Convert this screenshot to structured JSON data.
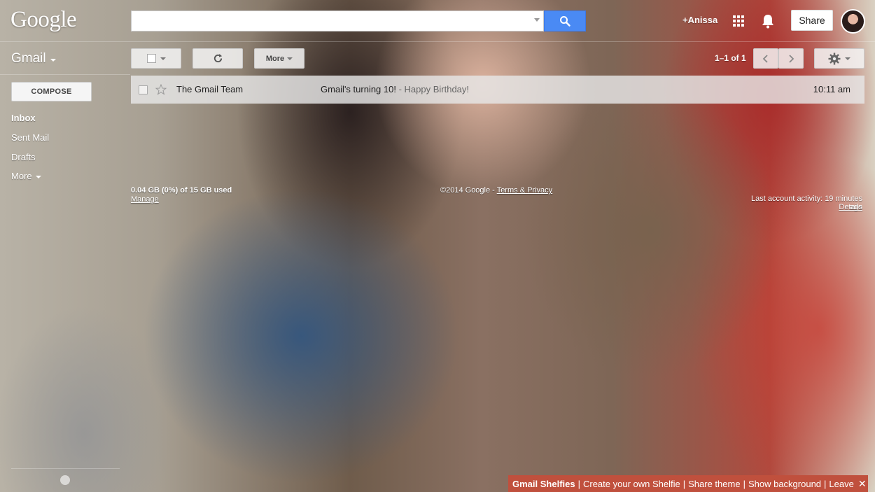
{
  "header": {
    "logo": "Google",
    "search_value": "",
    "user_link": "+Anissa",
    "share_label": "Share"
  },
  "toolbar": {
    "app_label": "Gmail",
    "more_label": "More",
    "pager_text": "1–1 of 1"
  },
  "sidebar": {
    "compose_label": "COMPOSE",
    "items": [
      {
        "label": "Inbox"
      },
      {
        "label": "Sent Mail"
      },
      {
        "label": "Drafts"
      },
      {
        "label": "More"
      }
    ]
  },
  "messages": [
    {
      "sender": "The Gmail Team",
      "subject": "Gmail's turning 10!",
      "snippet": " - Happy Birthday!",
      "time": "10:11 am"
    }
  ],
  "footer": {
    "storage": "0.04 GB (0%) of 15 GB used",
    "manage": "Manage",
    "copyright": "©2014 Google - ",
    "terms": "Terms & Privacy",
    "activity": "Last account activity: 19 minutes ago",
    "details": "Details"
  },
  "banner": {
    "title": "Gmail Shelfies",
    "create": "Create your own Shelfie",
    "share_theme": "Share theme",
    "show_background": "Show background",
    "leave": "Leave",
    "sep": "|",
    "close": "✕"
  },
  "colors": {
    "search_button": "#4a8af4",
    "banner": "#c0503d"
  },
  "icons": {
    "search": "search-icon",
    "apps": "apps-grid-icon",
    "notifications": "bell-icon",
    "refresh": "refresh-icon",
    "settings": "gear-icon",
    "star": "star-icon",
    "prev": "chevron-left-icon",
    "next": "chevron-right-icon"
  }
}
